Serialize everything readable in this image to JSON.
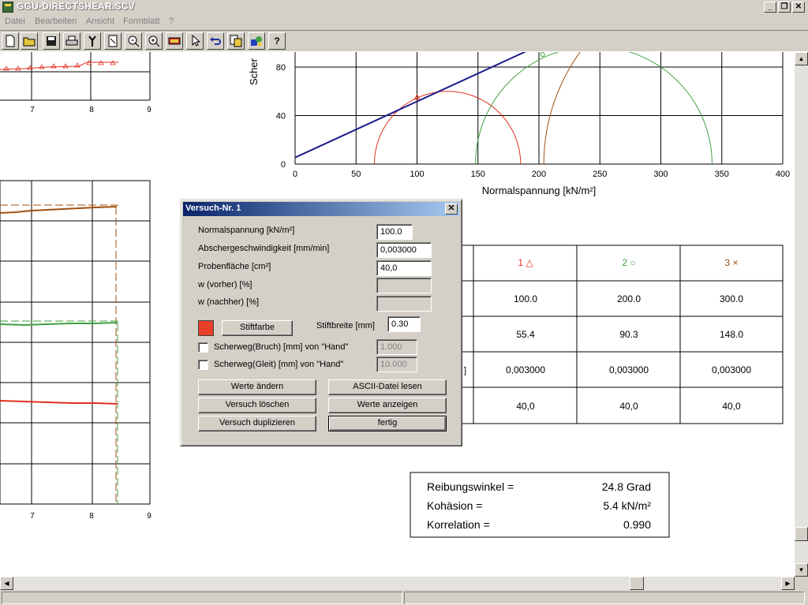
{
  "app": {
    "title": "GGU-DIRECTSHEAR.SCV"
  },
  "window_controls": {
    "minimize": "_",
    "maximize": "❐",
    "close": "✕"
  },
  "menu": [
    {
      "label": "Datei"
    },
    {
      "label": "Bearbeiten"
    },
    {
      "label": "Ansicht"
    },
    {
      "label": "Formblatt"
    },
    {
      "label": "?"
    }
  ],
  "toolbar": [
    {
      "icon": "new-file-icon"
    },
    {
      "icon": "open-folder-icon"
    },
    {
      "icon": "save-icon"
    },
    {
      "icon": "print-icon"
    },
    {
      "icon": "tools-icon"
    },
    {
      "icon": "page-view-icon"
    },
    {
      "icon": "zoom-out-icon"
    },
    {
      "icon": "zoom-in-icon"
    },
    {
      "icon": "fill-icon"
    },
    {
      "icon": "pointer-icon"
    },
    {
      "icon": "undo-icon"
    },
    {
      "icon": "copy-icon"
    },
    {
      "icon": "shapes-icon"
    },
    {
      "icon": "help-icon"
    }
  ],
  "toolbar_help_label": "?",
  "left_chart_top": {
    "x_ticks": [
      "7",
      "8",
      "9"
    ]
  },
  "left_chart_bottom": {
    "x_ticks": [
      "7",
      "8",
      "9"
    ]
  },
  "mohr_chart": {
    "ylabel": "Scher",
    "xlabel": "Normalspannung [kN/m²]",
    "x_ticks": [
      "0",
      "50",
      "100",
      "150",
      "200",
      "250",
      "300",
      "350",
      "400"
    ],
    "y_ticks": [
      "0",
      "40",
      "80"
    ],
    "xlim": [
      0,
      400
    ],
    "ylim": [
      0,
      90
    ],
    "line": {
      "cohesion": 5.4,
      "angle_deg": 24.8,
      "color": "#1c1c8c"
    },
    "circles": [
      {
        "center": 125,
        "radius": 60,
        "color": "#e03020"
      },
      {
        "center": 245,
        "radius": 97,
        "color": "#40a040"
      },
      {
        "center": 362,
        "radius": 158,
        "color": "#a05010"
      }
    ]
  },
  "results_table": {
    "headers": [
      "1 △",
      "2 ○",
      "3 ×"
    ],
    "header_colors": [
      "#e03020",
      "#40a040",
      "#a05010"
    ],
    "row_label_fragment": "]",
    "rows": [
      [
        "100.0",
        "200.0",
        "300.0"
      ],
      [
        "55.4",
        "90.3",
        "148.0"
      ],
      [
        "0,003000",
        "0,003000",
        "0,003000"
      ],
      [
        "40,0",
        "40,0",
        "40,0"
      ]
    ]
  },
  "summary": {
    "friction_label": "Reibungswinkel =",
    "friction_value": "24.8 Grad",
    "cohesion_label": "Kohäsion  =",
    "cohesion_value": "5.4 kN/m²",
    "correlation_label": "Korrelation  =",
    "correlation_value": "0.990"
  },
  "dialog": {
    "title": "Versuch-Nr. 1",
    "close": "✕",
    "normal_label": "Normalspannung [kN/m²]",
    "normal_value": "100.0",
    "rate_label": "Abschergeschwindigkeit [mm/min]",
    "rate_value": "0,003000",
    "area_label": "Probenfläche [cm²]",
    "area_value": "40,0",
    "w_before_label": "w (vorher) [%]",
    "w_after_label": "w (nachher) [%]",
    "pen_color_button": "Stiftfarbe",
    "pen_color": "#e8402a",
    "pen_width_label": "Stiftbreite [mm]",
    "pen_width_value": "0.30",
    "break_label": "Scherweg(Bruch) [mm] von \"Hand\"",
    "break_value": "1.000",
    "slide_label": "Scherweg(Gleit) [mm] von \"Hand\"",
    "slide_value": "10.000",
    "btn_change": "Werte ändern",
    "btn_ascii": "ASCII-Datei lesen",
    "btn_delete": "Versuch löschen",
    "btn_show": "Werte anzeigen",
    "btn_duplicate": "Versuch duplizieren",
    "btn_done": "fertig"
  },
  "scroll": {
    "up": "▲",
    "down": "▼",
    "left": "◀",
    "right": "▶"
  }
}
